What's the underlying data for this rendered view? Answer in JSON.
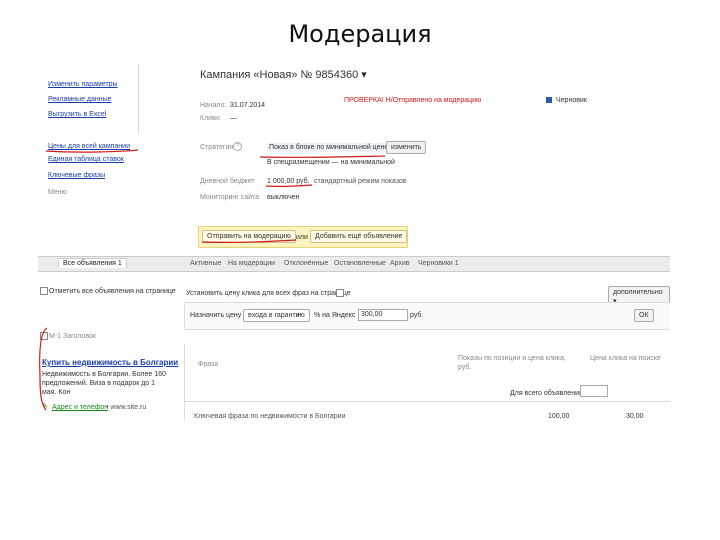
{
  "slide_title": "Модерация",
  "sidebar": {
    "links": [
      "Изменить параметры",
      "Рекламные данные",
      "Выгрузить в Excel"
    ],
    "price_link": "Цены для всей кампании",
    "more_links": [
      "Единая таблица ставок",
      "Ключевые фразы"
    ],
    "misc": "Меню"
  },
  "campaign": {
    "heading": "Кампания «Новая» № 9854360 ▾",
    "status": "ПРОВЕРКА! Н/Отправлено на модерацию",
    "drafts": "Черновик",
    "start_label": "Начало:",
    "start_value": "31.07.2014",
    "clicks_label": "Клики:",
    "clicks_value": "—",
    "strategy_label": "Стратегия",
    "strategy_value": "Показ в блоке по минимальной цене",
    "strategy_change": "изменить",
    "strategy_sub": "В спецразмещении — на минимальной",
    "budget_label": "Дневной бюджет",
    "budget_value": "1 000,00 руб.",
    "budget_note": "стандартный режим показов",
    "monitoring_label": "Мониторинг сайта",
    "monitoring_value": "выключен"
  },
  "actions": {
    "send": "Отправить на модерацию",
    "or": "или",
    "add": "Добавить ещё объявление"
  },
  "tabs": {
    "items": [
      "Все объявления 1",
      "Активные",
      "На модерации",
      "Отклонённые",
      "Остановленные",
      "Архив",
      "Черновики 1"
    ]
  },
  "bulk": {
    "select_all": "Отметить все объявления на странице",
    "set_price": "Установить цену клика для всех фраз на странице",
    "extra": "дополнительно ▾",
    "assign_label": "Назначить цену",
    "assign_select": "входа в гарантию",
    "assign_plus": "+",
    "assign_percent": "% на Яндекс",
    "assign_value": "300,00",
    "assign_unit": "руб.",
    "ok": "ОК"
  },
  "ad": {
    "label": "М-1 Заголовок",
    "title": "Купить недвижимость в Болгарии",
    "body": "Недвижимость в Болгарии. Более 160 предложений. Виза в подарок до 1 мая. Кон",
    "url_label": "Адрес и телефон",
    "url": "• www.site.ru"
  },
  "table": {
    "col_phrases": "Фраза",
    "col_price": "Показы по позиции и цена клика, руб.",
    "col_right": "Цена клика на поиске",
    "for_all": "Для всего объявления:",
    "row_snippet": "Ключевая фраза по недвижимости в Болгарии",
    "row_val1": "100,00",
    "row_val2": "30,00"
  }
}
